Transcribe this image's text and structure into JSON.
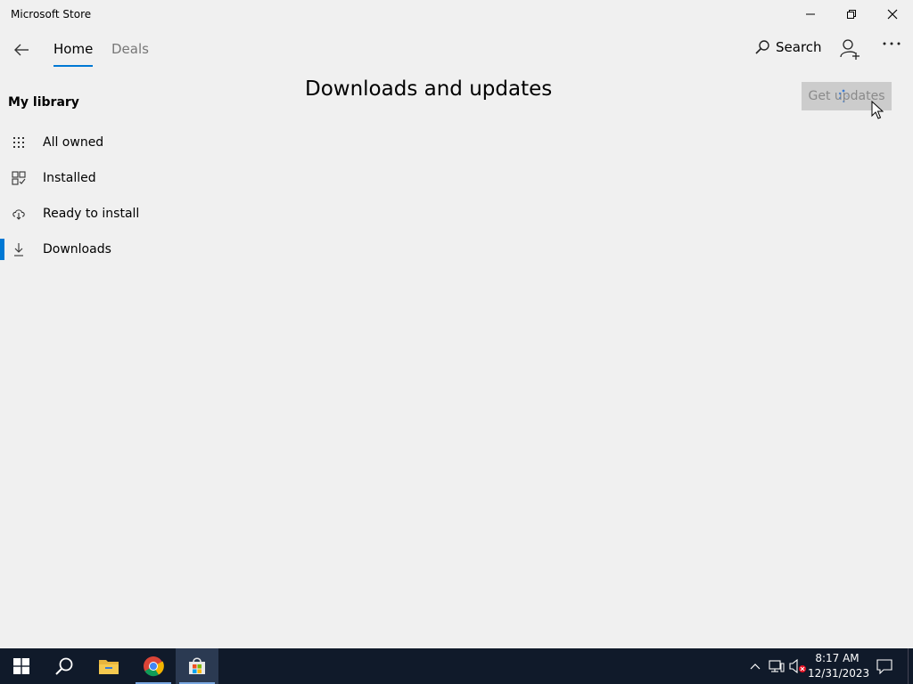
{
  "window": {
    "title": "Microsoft Store"
  },
  "nav": {
    "tabs": [
      {
        "label": "Home",
        "active": true
      },
      {
        "label": "Deals",
        "active": false
      }
    ],
    "search_label": "Search"
  },
  "sidebar": {
    "title": "My library",
    "items": [
      {
        "label": "All owned",
        "icon": "grid-icon",
        "active": false
      },
      {
        "label": "Installed",
        "icon": "installed-icon",
        "active": false
      },
      {
        "label": "Ready to install",
        "icon": "cloud-download-icon",
        "active": false
      },
      {
        "label": "Downloads",
        "icon": "download-icon",
        "active": true
      }
    ]
  },
  "main": {
    "heading": "Downloads and updates",
    "get_updates_label": "Get updates"
  },
  "taskbar": {
    "time": "8:17 AM",
    "date": "12/31/2023"
  },
  "colors": {
    "accent": "#0078d4",
    "background": "#f0f0f0",
    "taskbar": "#101a2a",
    "button_disabled": "#cccccc"
  }
}
